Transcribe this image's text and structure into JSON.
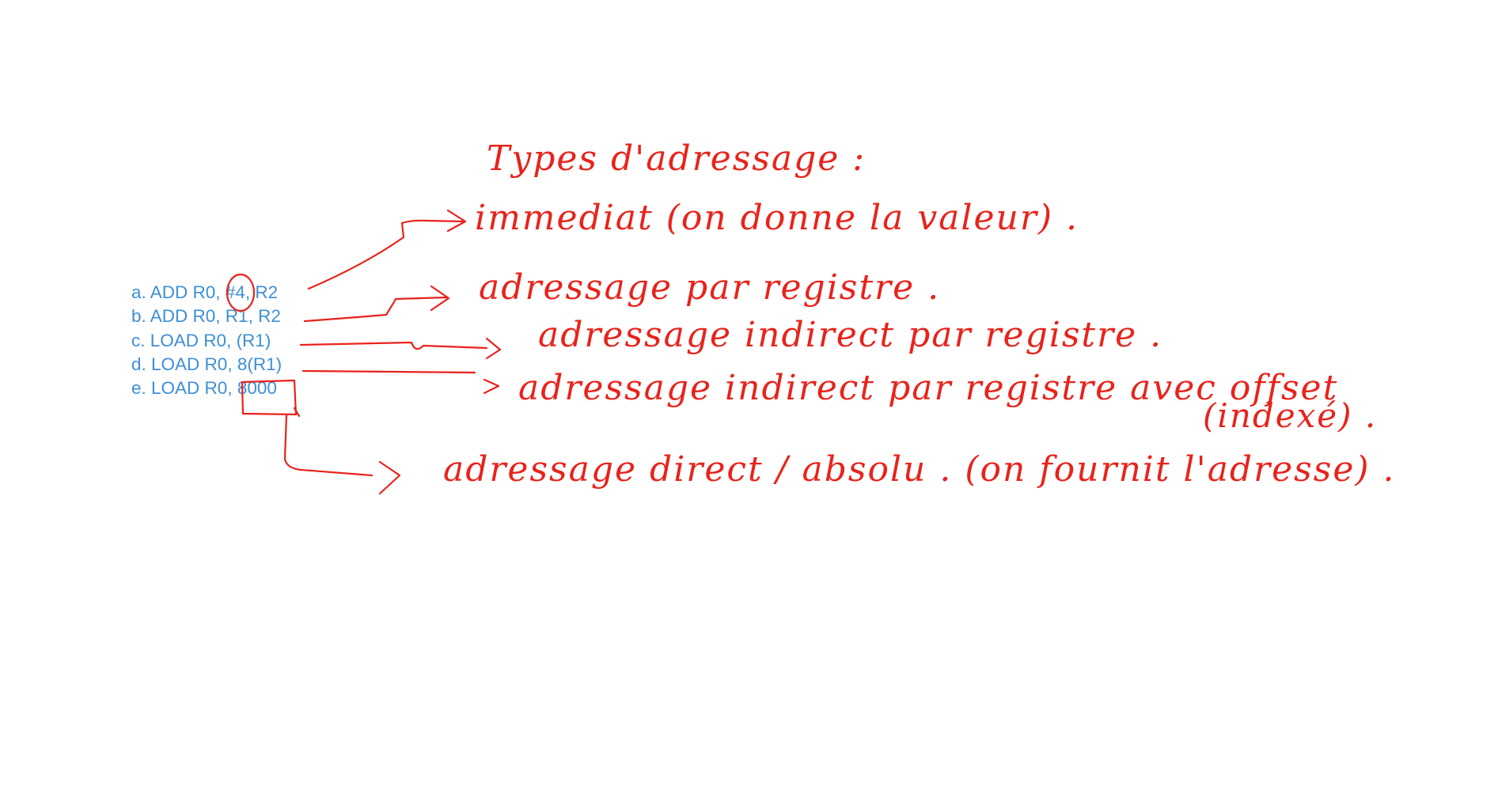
{
  "colors": {
    "background": "#ffffff",
    "typed_text": "#3d8fd6",
    "ink": "#e8231b"
  },
  "instructions": [
    {
      "prefix": "a.",
      "text": "ADD R0, #4, R2"
    },
    {
      "prefix": "b.",
      "text": "ADD R0, R1, R2"
    },
    {
      "prefix": "c.",
      "text": "LOAD R0, (R1)"
    },
    {
      "prefix": "d.",
      "text": "LOAD R0, 8(R1)"
    },
    {
      "prefix": "e.",
      "text": "LOAD R0, 8000"
    }
  ],
  "handwriting": {
    "title": "Types d'adressage :",
    "immediate": "immediat (on donne la valeur) .",
    "register": "adressage par registre .",
    "indirect_register": "adressage indirect par registre .",
    "indirect_offset": "adressage indirect par registre avec offset",
    "indexed": "(indexé) .",
    "direct_absolute": "adressage direct / absolu . (on fournit l'adresse) ."
  }
}
